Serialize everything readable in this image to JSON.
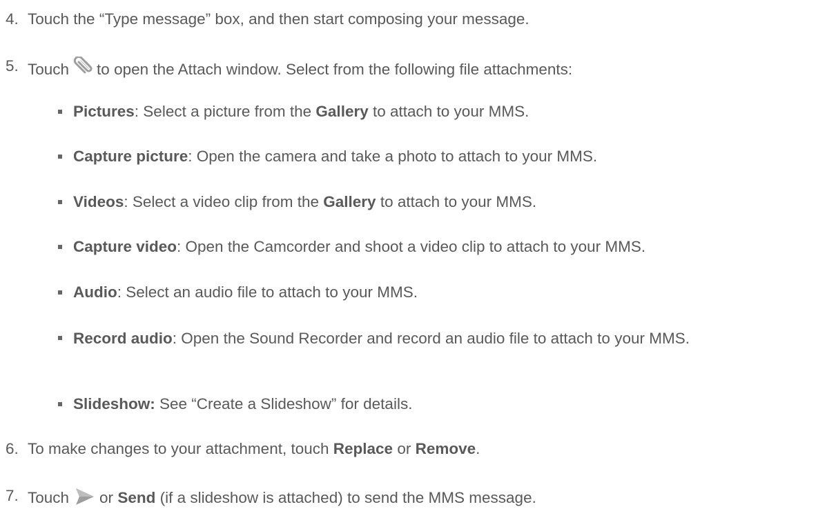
{
  "steps": [
    {
      "number": "4.",
      "text": "Touch the “Type message” box, and then start composing your message."
    },
    {
      "number": "5.",
      "pre": "Touch",
      "icon": "paperclip-icon",
      "post": "to open the Attach window. Select from the following file attachments:"
    },
    {
      "number": "6.",
      "pre": "To make changes to your attachment, touch ",
      "b1": "Replace",
      "mid": " or ",
      "b2": "Remove",
      "post": "."
    },
    {
      "number": "7.",
      "pre": "Touch",
      "icon": "send-icon",
      "mid": "or ",
      "b1": "Send",
      "post": " (if a slideshow is attached) to send the MMS message."
    }
  ],
  "attachments": [
    {
      "term": "Pictures",
      "t1": ": Select a picture from the ",
      "b2": "Gallery",
      "t2": " to attach to your MMS."
    },
    {
      "term": "Capture picture",
      "t1": ": Open the camera and take a photo to attach to your MMS."
    },
    {
      "term": "Videos",
      "t1": ": Select a video clip from the ",
      "b2": "Gallery",
      "t2": " to attach to your MMS."
    },
    {
      "term": "Capture video",
      "t1": ": Open the Camcorder and shoot a video clip to attach to your MMS."
    },
    {
      "term": "Audio",
      "t1": ": Select an audio file to attach to your MMS."
    },
    {
      "term": "Record audio",
      "t1": ": Open the Sound Recorder and record an audio file to attach to your MMS."
    },
    {
      "term": "Slideshow:",
      "t1": " See “Create a Slideshow” for details."
    }
  ],
  "colors": {
    "text": "#595959",
    "bullet": "#666666",
    "icon": "#9e9e9e"
  }
}
